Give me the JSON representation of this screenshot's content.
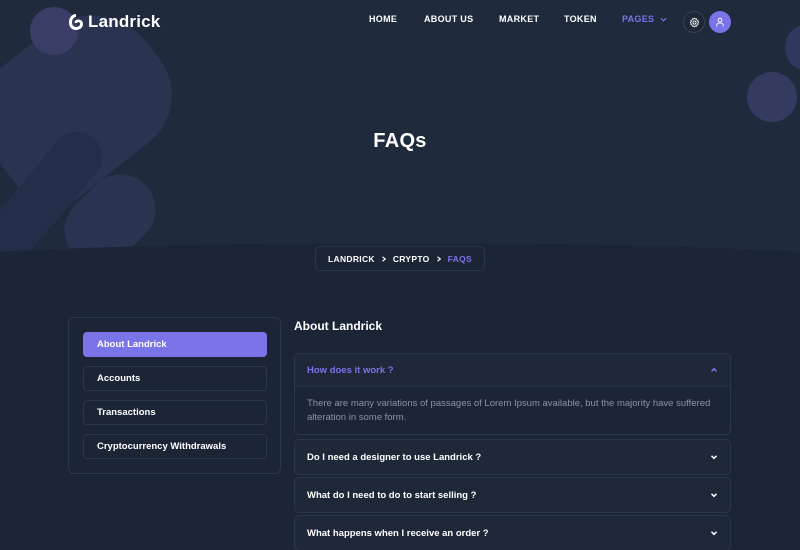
{
  "brand": {
    "name": "Landrick",
    "accent": "#7b73e8"
  },
  "nav": {
    "items": [
      {
        "label": "HOME"
      },
      {
        "label": "ABOUT US"
      },
      {
        "label": "MARKET"
      },
      {
        "label": "TOKEN"
      },
      {
        "label": "PAGES",
        "active": true,
        "icon": "chevron-down-icon"
      }
    ],
    "settings_icon": "gear-icon",
    "user_icon": "user-icon"
  },
  "hero": {
    "title": "FAQs"
  },
  "breadcrumb": {
    "items": [
      "LANDRICK",
      "CRYPTO",
      "FAQS"
    ],
    "separator_icon": "chevron-right-icon"
  },
  "sidebar": {
    "items": [
      {
        "label": "About Landrick",
        "active": true
      },
      {
        "label": "Accounts"
      },
      {
        "label": "Transactions"
      },
      {
        "label": "Cryptocurrency Withdrawals"
      }
    ]
  },
  "faq": {
    "heading": "About Landrick",
    "items": [
      {
        "question": "How does it work ?",
        "answer": "There are many variations of passages of Lorem Ipsum available, but the majority have suffered alteration in some form.",
        "open": true
      },
      {
        "question": "Do I need a designer to use Landrick ?"
      },
      {
        "question": "What do I need to do to start selling ?"
      },
      {
        "question": "What happens when I receive an order ?"
      }
    ]
  }
}
